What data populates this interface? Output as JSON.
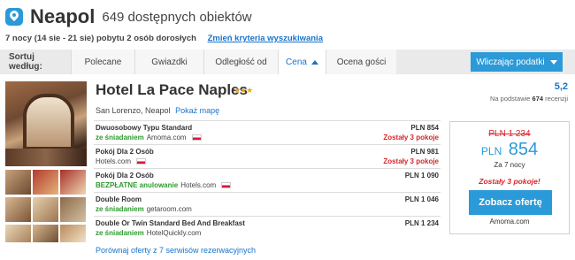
{
  "header": {
    "city": "Neapol",
    "count_text": "649 dostępnych obiektów",
    "icon": "map-pin-icon"
  },
  "subheader": {
    "stay_info": "7 nocy (14 sie - 21 sie) pobytu 2 osób dorosłych",
    "change_link": "Zmień kryteria wyszukiwania"
  },
  "sortbar": {
    "label": "Sortuj według:",
    "options": [
      "Polecane",
      "Gwiazdki",
      "Odległość od",
      "Cena",
      "Ocena gości"
    ],
    "active": "Cena",
    "tax_toggle": "Wliczając podatki"
  },
  "hotel": {
    "name": "Hotel La Pace Naples",
    "stars": "★★★",
    "star_count": 3,
    "rating": "5,2",
    "reviews_prefix": "Na podstawie",
    "reviews_count": "674",
    "reviews_suffix": "recenzji",
    "location": "San Lorenzo, Neapol",
    "map_link": "Pokaż mapę",
    "offers": [
      {
        "room": "Dwuosobowy Typu Standard",
        "tag": "ze śniadaniem",
        "provider": "Amoma.com",
        "flag": true,
        "price": "PLN 854",
        "availability": "Zostały 3 pokoje"
      },
      {
        "room": "Pokój Dla 2 Osób",
        "tag": "",
        "provider": "Hotels.com",
        "flag": true,
        "price": "PLN 981",
        "availability": "Zostały 3 pokoje"
      },
      {
        "room": "Pokój Dla 2 Osób",
        "tag": "BEZPŁATNE anulowanie",
        "provider": "Hotels.com",
        "flag": true,
        "price": "PLN 1 090",
        "availability": ""
      },
      {
        "room": "Double Room",
        "tag": "ze śniadaniem",
        "provider": "getaroom.com",
        "flag": false,
        "price": "PLN 1 046",
        "availability": ""
      },
      {
        "room": "Double Or Twin Standard Bed And Breakfast",
        "tag": "ze śniadaniem",
        "provider": "HotelQuickly.com",
        "flag": false,
        "price": "PLN 1 234",
        "availability": ""
      }
    ],
    "compare_link": "Porównaj oferty z 7 serwisów rezerwacyjnych"
  },
  "pricebox": {
    "old_price": "PLN 1 234",
    "currency": "PLN",
    "amount": "854",
    "nights": "Za 7 nocy",
    "availability": "Zostały 3 pokoje!",
    "cta": "Zobacz ofertę",
    "provider": "Amoma.com"
  },
  "colors": {
    "accent": "#2b9ad8",
    "link": "#1a73c9",
    "alert": "#d9262b",
    "green": "#2e9a2e",
    "star": "#f2a600"
  }
}
